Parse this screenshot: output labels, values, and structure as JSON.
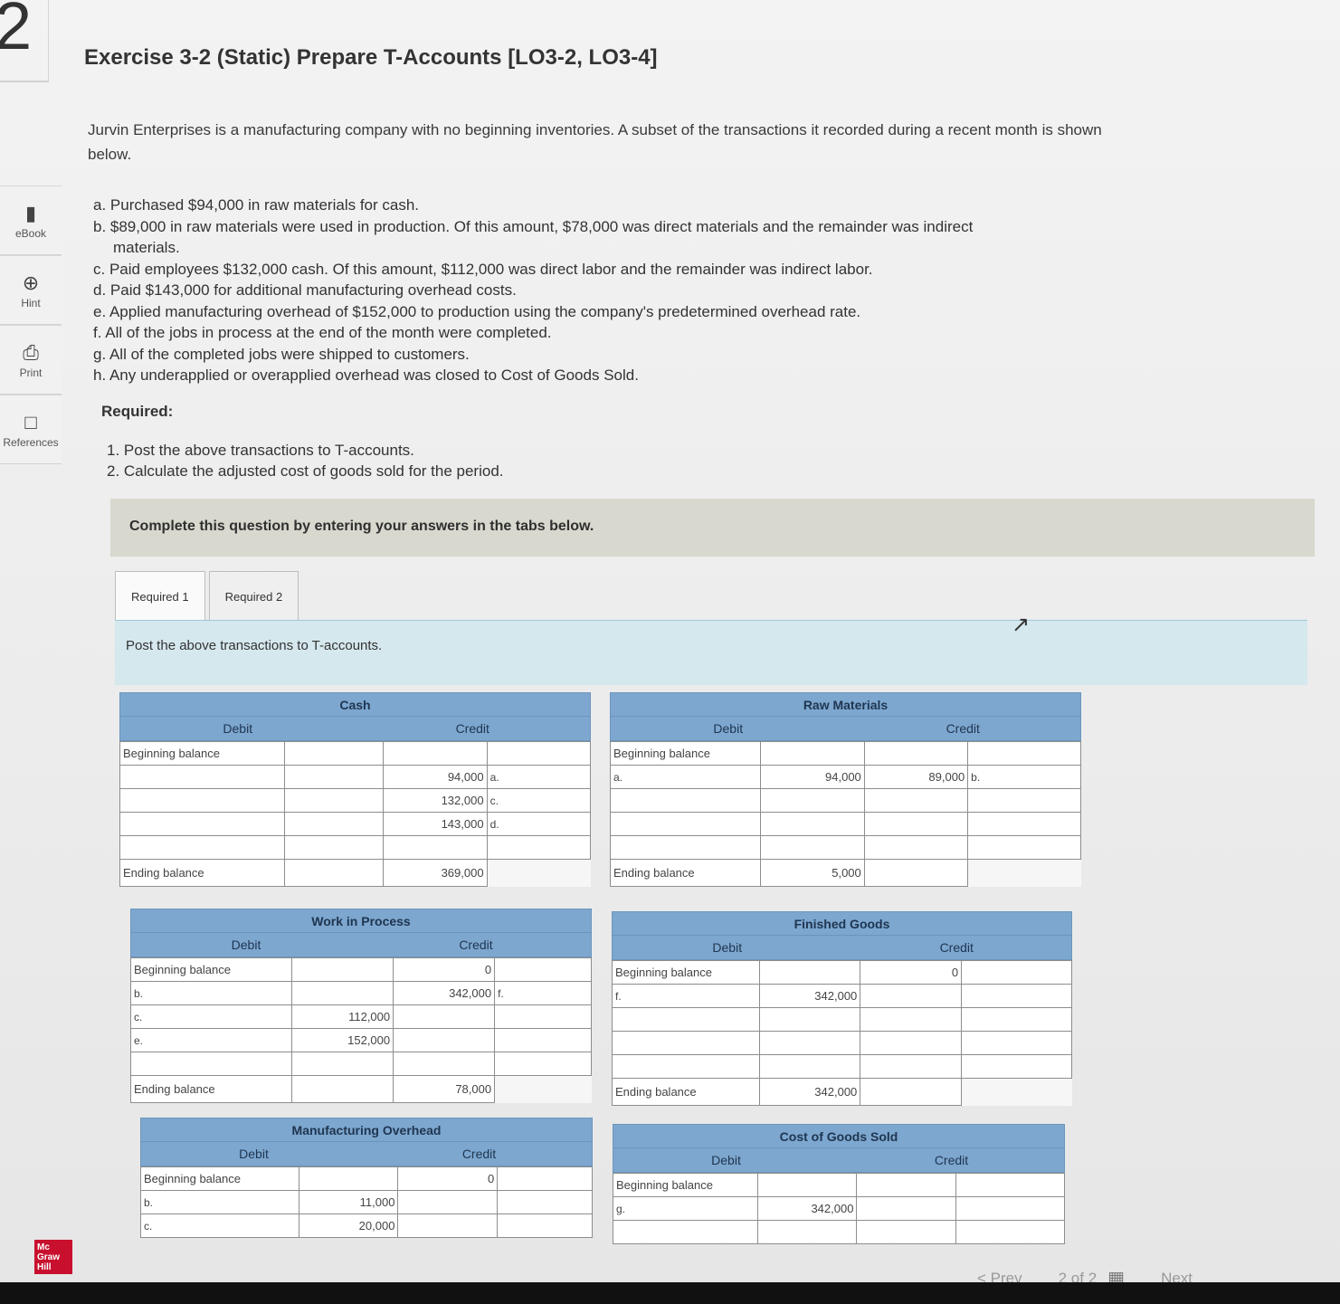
{
  "question_number": "2",
  "title": "Exercise 3-2 (Static) Prepare T-Accounts [LO3-2, LO3-4]",
  "sidebar": {
    "items": [
      {
        "label": "eBook",
        "icon": "book-icon"
      },
      {
        "label": "Hint",
        "icon": "globe-icon"
      },
      {
        "label": "Print",
        "icon": "printer-icon"
      },
      {
        "label": "References",
        "icon": "document-icon"
      }
    ]
  },
  "intro": "Jurvin Enterprises is a manufacturing company with no beginning inventories. A subset of the transactions it recorded during a recent month is shown below.",
  "transactions": [
    "a. Purchased $94,000 in raw materials for cash.",
    "b. $89,000 in raw materials were used in production. Of this amount, $78,000 was direct materials and the remainder was indirect",
    "materials.",
    "c. Paid employees $132,000 cash. Of this amount, $112,000 was direct labor and the remainder was indirect labor.",
    "d. Paid $143,000 for additional manufacturing overhead costs.",
    "e. Applied manufacturing overhead of $152,000 to production using the company's predetermined overhead rate.",
    "f. All of the jobs in process at the end of the month were completed.",
    "g. All of the completed jobs were shipped to customers.",
    "h. Any underapplied or overapplied overhead was closed to Cost of Goods Sold."
  ],
  "required_heading": "Required:",
  "required": [
    "1. Post the above transactions to T-accounts.",
    "2. Calculate the adjusted cost of goods sold for the period."
  ],
  "complete_bar": "Complete this question by entering your answers in the tabs below.",
  "tabs": [
    {
      "label": "Required 1"
    },
    {
      "label": "Required 2"
    }
  ],
  "panel_instruction": "Post the above transactions to T-accounts.",
  "labels": {
    "debit": "Debit",
    "credit": "Credit",
    "beginning": "Beginning balance",
    "ending": "Ending balance"
  },
  "accounts": {
    "cash": {
      "title": "Cash",
      "rows": [
        [
          "",
          "",
          "94,000",
          "a."
        ],
        [
          "",
          "",
          "132,000",
          "c."
        ],
        [
          "",
          "",
          "143,000",
          "d."
        ],
        [
          "",
          "",
          "",
          ""
        ]
      ],
      "ending": [
        "",
        "369,000"
      ]
    },
    "raw_materials": {
      "title": "Raw Materials",
      "rows": [
        [
          "a.",
          "94,000",
          "89,000",
          "b."
        ],
        [
          "",
          "",
          "",
          ""
        ],
        [
          "",
          "",
          "",
          ""
        ],
        [
          "",
          "",
          "",
          ""
        ]
      ],
      "ending": [
        "5,000",
        ""
      ]
    },
    "wip": {
      "title": "Work in Process",
      "begin_credit": "0",
      "rows": [
        [
          "b.",
          "",
          "342,000",
          "f."
        ],
        [
          "c.",
          "112,000",
          "",
          ""
        ],
        [
          "e.",
          "152,000",
          "",
          ""
        ],
        [
          "",
          "",
          "",
          ""
        ]
      ],
      "ending": [
        "",
        "78,000"
      ]
    },
    "finished_goods": {
      "title": "Finished Goods",
      "begin_credit": "0",
      "rows": [
        [
          "f.",
          "342,000",
          "",
          ""
        ],
        [
          "",
          "",
          "",
          ""
        ],
        [
          "",
          "",
          "",
          ""
        ],
        [
          "",
          "",
          "",
          ""
        ]
      ],
      "ending": [
        "342,000",
        ""
      ]
    },
    "mfg_overhead": {
      "title": "Manufacturing Overhead",
      "begin_credit": "0",
      "rows": [
        [
          "b.",
          "11,000",
          "",
          ""
        ],
        [
          "c.",
          "20,000",
          "",
          ""
        ]
      ]
    },
    "cogs": {
      "title": "Cost of Goods Sold",
      "rows": [
        [
          "g.",
          "342,000",
          "",
          ""
        ],
        [
          "",
          "",
          "",
          ""
        ]
      ]
    }
  },
  "footer": {
    "logo": "Mc Graw Hill",
    "prev": "< Prev",
    "page": "2 of 2",
    "next": "Next"
  }
}
